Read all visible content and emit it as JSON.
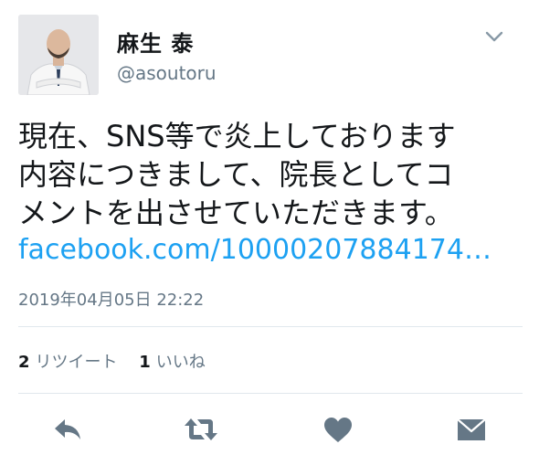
{
  "user": {
    "display_name": "麻生 泰",
    "screen_name": "@asoutoru"
  },
  "tweet": {
    "text_lines": [
      "現在、SNS等で炎上しております",
      "内容につきまして、院長としてコ",
      "メントを出させていただきます。"
    ],
    "link": "facebook.com/10000207884174…",
    "timestamp": "2019年04月05日 22:22"
  },
  "stats": {
    "retweets_count": "2",
    "retweets_label": "リツイート",
    "likes_count": "1",
    "likes_label": "いいね"
  },
  "icons": {
    "menu": "chevron-down-icon",
    "reply": "reply-icon",
    "retweet": "retweet-icon",
    "like": "heart-icon",
    "dm": "envelope-icon"
  },
  "colors": {
    "link": "#1da1f2",
    "secondary_text": "#657786",
    "icon": "#657786",
    "divider": "#e1e8ed"
  }
}
